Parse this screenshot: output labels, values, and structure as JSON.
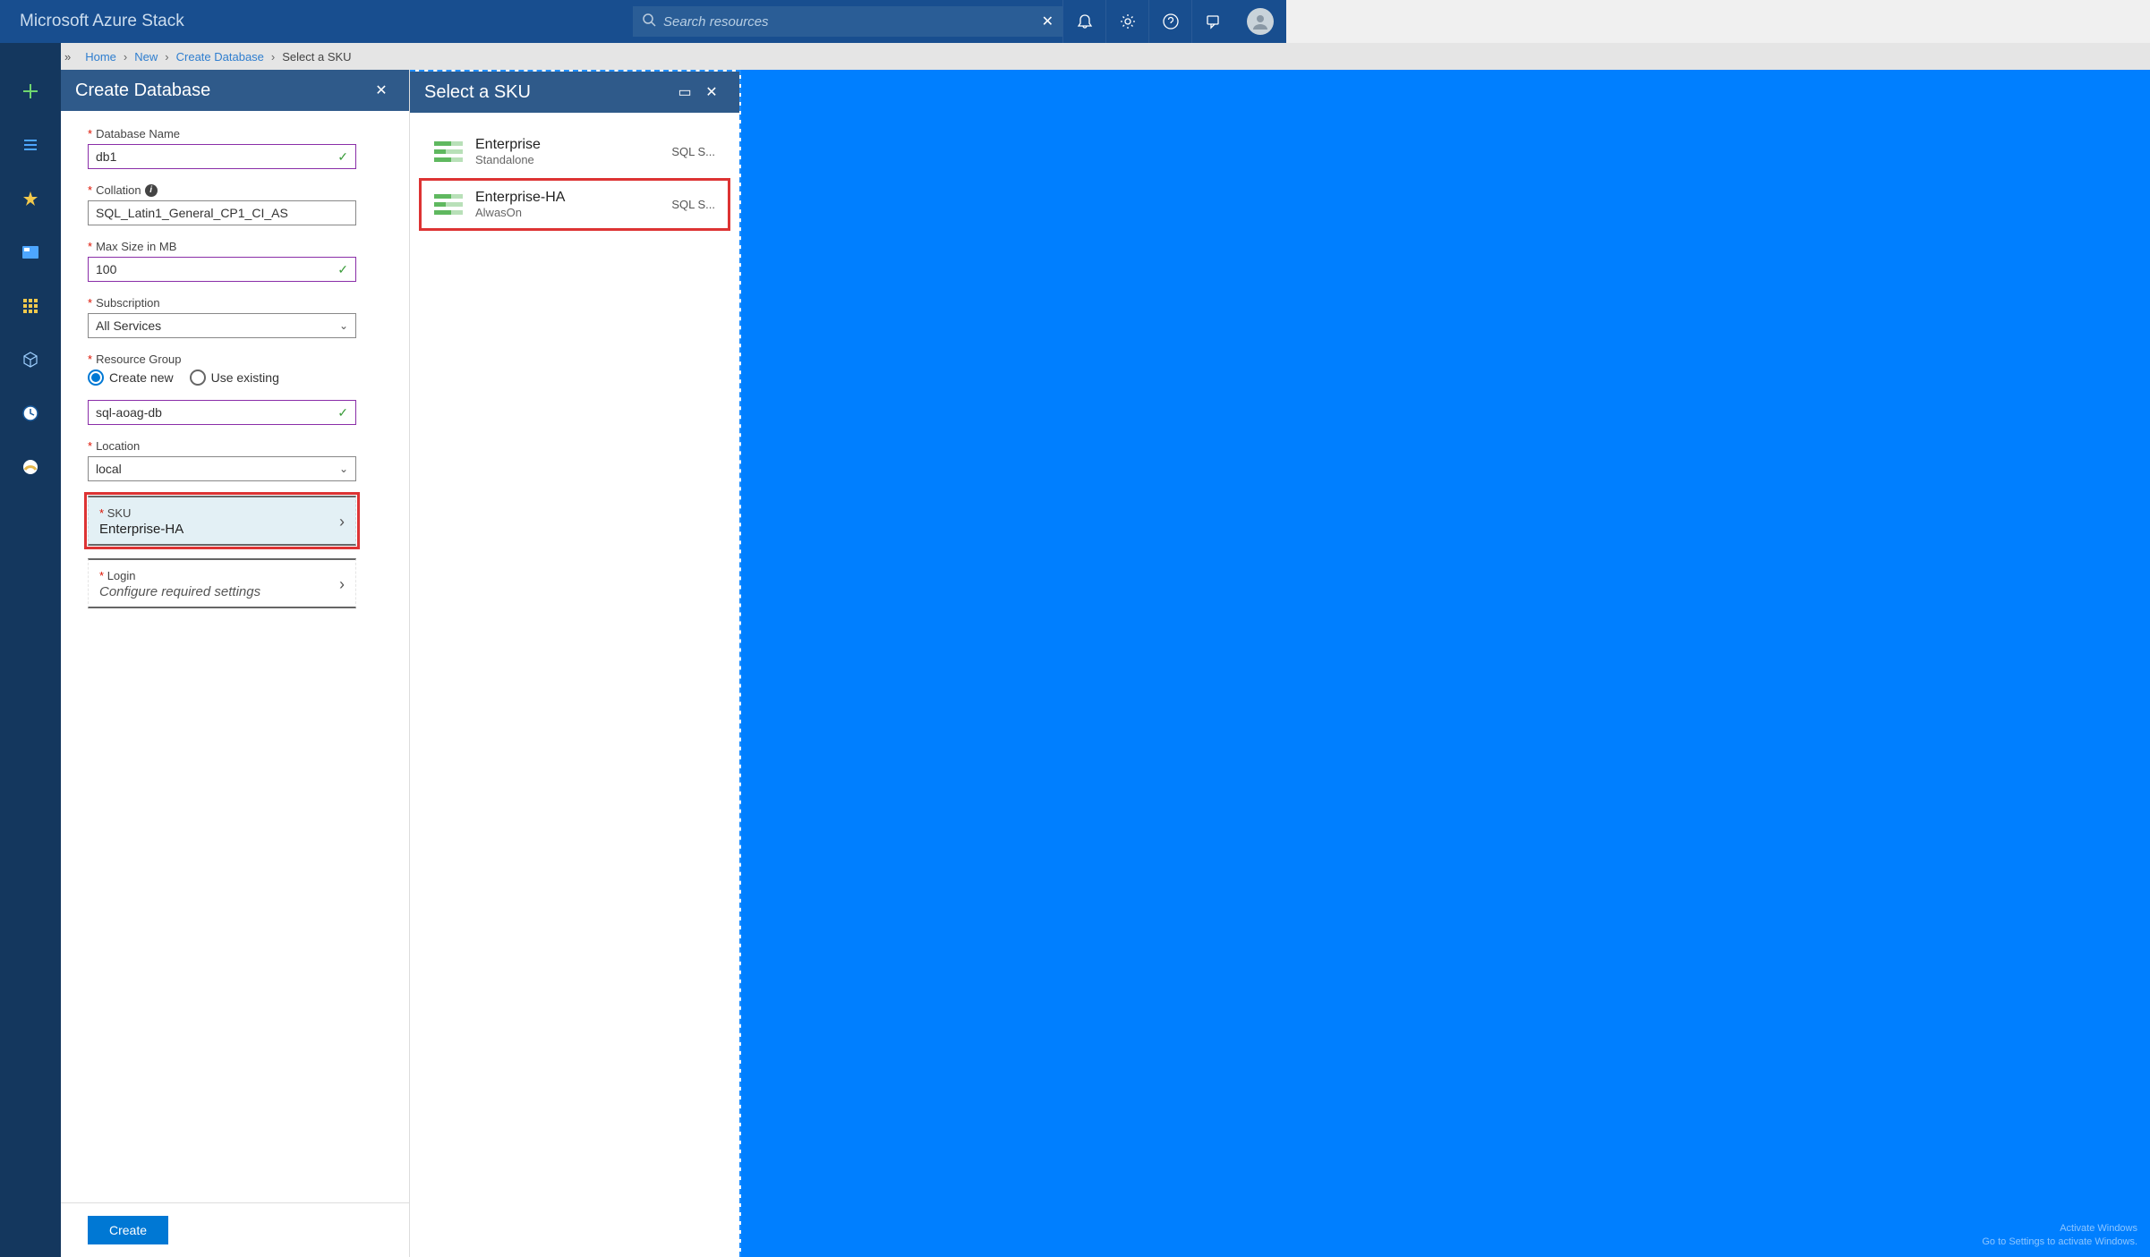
{
  "header": {
    "brand": "Microsoft Azure Stack",
    "search_placeholder": "Search resources"
  },
  "breadcrumb": [
    "Home",
    "New",
    "Create Database",
    "Select a SKU"
  ],
  "blade1": {
    "title": "Create Database",
    "fields": {
      "db_name_label": "Database Name",
      "db_name": "db1",
      "collation_label": "Collation",
      "collation": "SQL_Latin1_General_CP1_CI_AS",
      "maxsize_label": "Max Size in MB",
      "maxsize": "100",
      "subscription_label": "Subscription",
      "subscription": "All Services",
      "rg_label": "Resource Group",
      "rg_create": "Create new",
      "rg_use": "Use existing",
      "rg_name": "sql-aoag-db",
      "location_label": "Location",
      "location": "local",
      "sku_label": "SKU",
      "sku_value": "Enterprise-HA",
      "login_label": "Login",
      "login_value": "Configure required settings"
    },
    "create_btn": "Create"
  },
  "blade2": {
    "title": "Select a SKU",
    "skus": [
      {
        "name": "Enterprise",
        "sub": "Standalone",
        "extra": "SQL S..."
      },
      {
        "name": "Enterprise-HA",
        "sub": "AlwasOn",
        "extra": "SQL S..."
      }
    ]
  },
  "watermark": {
    "l1": "Activate Windows",
    "l2": "Go to Settings to activate Windows."
  }
}
